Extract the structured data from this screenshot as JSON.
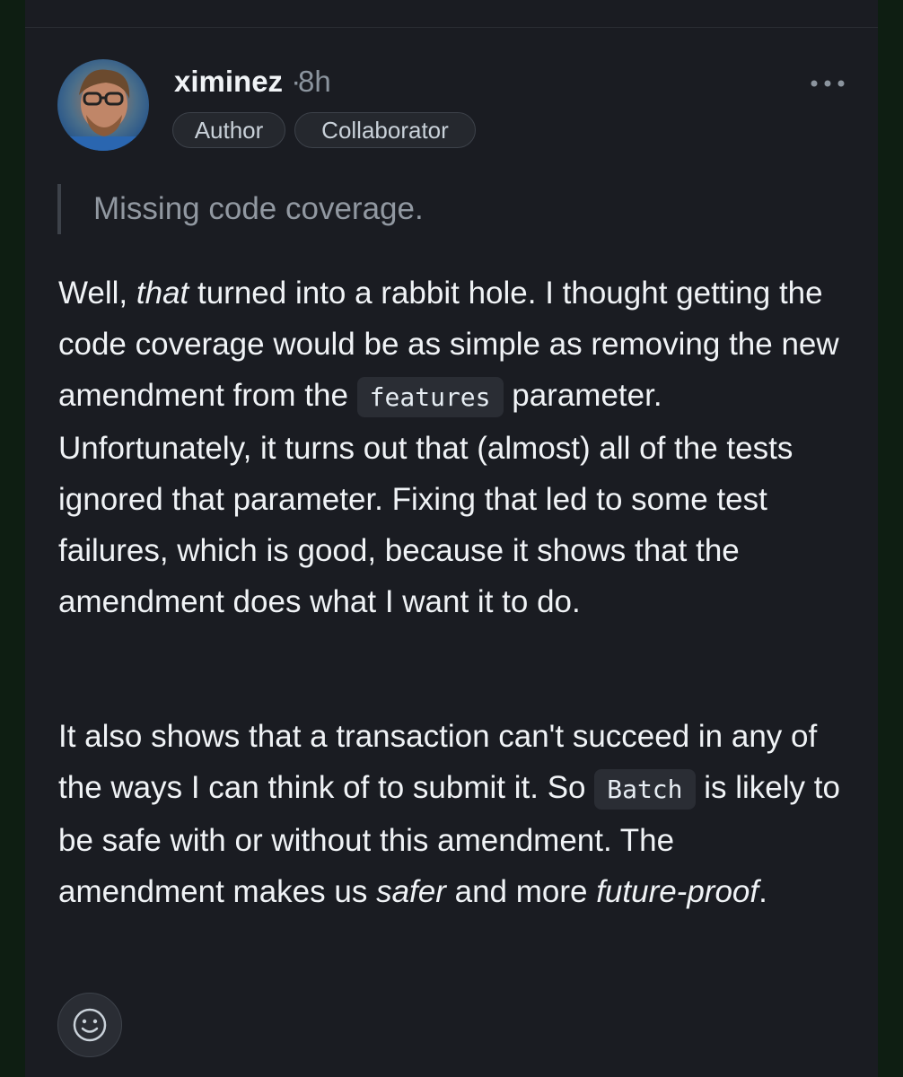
{
  "comment": {
    "username": "ximinez",
    "separator": "·",
    "time": "8h",
    "badges": [
      "Author",
      "Collaborator"
    ],
    "more_label": "•••",
    "quote": "Missing code coverage.",
    "paragraph1": {
      "t1": "Well, ",
      "em1": "that",
      "t2": " turned into a rabbit hole. I thought getting the code coverage would be as simple as removing the new amendment from the ",
      "code1": "features",
      "t3": " parameter. Unfortunately, it turns out that (almost) all of the tests ignored that parameter. Fixing that led to some test failures, which is good, because it shows that the amendment does what I want it to do."
    },
    "paragraph2": {
      "t1": "It also shows that a transaction can't succeed in any of the ways I can think of to submit it. So ",
      "code1": "Batch",
      "t2": " is likely to be safe with or without this amendment. The amendment makes us ",
      "em1": "safer",
      "t3": " and more ",
      "em2": "future-proof",
      "t4": "."
    }
  },
  "icons": {
    "avatar": "user-avatar-photo",
    "more": "more-horizontal-icon",
    "reaction": "smiley-icon"
  }
}
